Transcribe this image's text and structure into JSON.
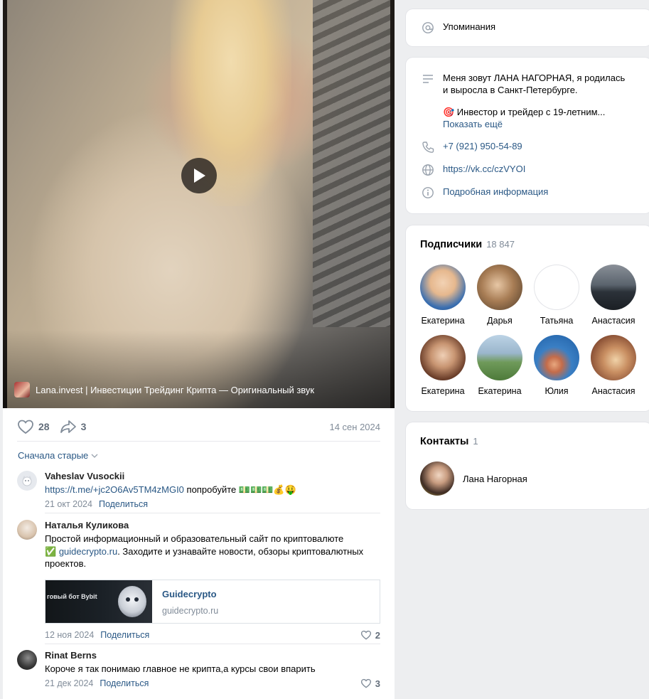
{
  "video": {
    "caption": "Lana.invest | Инвестиции Трейдинг Крипта — Оригинальный звук"
  },
  "post": {
    "likes": "28",
    "shares": "3",
    "date": "14 сен 2024"
  },
  "comments_sort": "Сначала старые",
  "comments": [
    {
      "author": "Vaheslav Vusockii",
      "link": "https://t.me/+jc2O6Av5TM4zMGI0",
      "text_after": " попробуйте 💵💵💵💰🤑",
      "date": "21 окт 2024",
      "share": "Поделиться"
    },
    {
      "author": "Наталья Куликова",
      "text_line1": "Простой информационный и образовательный сайт по криптовалюте",
      "check_icon": "✅",
      "link": "guidecrypto.ru",
      "text_rest": ". Заходите и узнавайте новости, обзоры криптовалютных проектов.",
      "card_title": "Guidecrypto",
      "card_domain": "guidecrypto.ru",
      "thumb_text": "говый бот Bybit",
      "date": "12 ноя 2024",
      "share": "Поделиться",
      "likes": "2"
    },
    {
      "author": "Rinat Berns",
      "text": "Короче я так понимаю главное не крипта,а курсы свои впарить",
      "date": "21 дек 2024",
      "share": "Поделиться",
      "likes": "3"
    }
  ],
  "mentions": {
    "label": "Упоминания",
    "icon": "at-icon"
  },
  "profile": {
    "bio_line1": "Меня зовут ЛАНА НАГОРНАЯ, я родилась",
    "bio_line2": "и выросла в Санкт-Петербурге.",
    "bio_line3": "🎯 Инвестор и трейдер с 19-летним...",
    "show_more": "Показать ещё",
    "phone": "+7 (921) 950-54-89",
    "site": "https://vk.cc/czVYOI",
    "details": "Подробная информация"
  },
  "subscribers": {
    "title": "Подписчики",
    "count": "18 847",
    "people": [
      {
        "name": "Екатерина",
        "color": "#3b6fb0"
      },
      {
        "name": "Дарья",
        "color": "#8a6a4a"
      },
      {
        "name": "Татьяна",
        "color": "#ffffff"
      },
      {
        "name": "Анастасия",
        "color": "#4a5560"
      },
      {
        "name": "Екатерина",
        "color": "#6b4a3a"
      },
      {
        "name": "Екатерина",
        "color": "#6f9a5a"
      },
      {
        "name": "Юлия",
        "color": "#3a7fc4"
      },
      {
        "name": "Анастасия",
        "color": "#b07a5a"
      }
    ]
  },
  "contacts": {
    "title": "Контакты",
    "count": "1",
    "name": "Лана Нагорная"
  }
}
